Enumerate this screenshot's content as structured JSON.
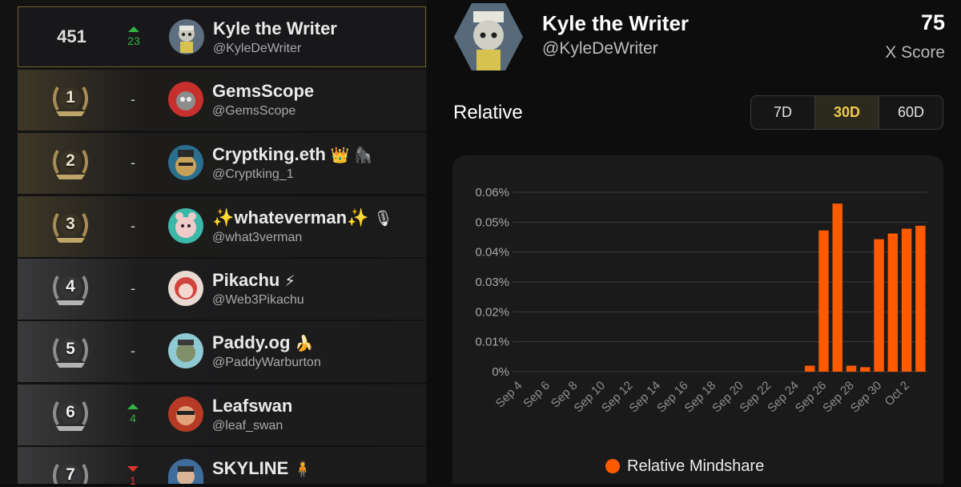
{
  "colors": {
    "accent_gold": "#f2c94c",
    "bar_orange": "#ff5a00",
    "up_green": "#2fb344",
    "down_red": "#e0322d"
  },
  "leaderboard": {
    "current_user": {
      "rank": "451",
      "change": "23",
      "change_dir": "up",
      "name": "Kyle the Writer",
      "handle": "@KyleDeWriter"
    },
    "rows": [
      {
        "rank": "1",
        "change": "-",
        "name": "GemsScope",
        "handle": "@GemsScope",
        "badges": ""
      },
      {
        "rank": "2",
        "change": "-",
        "name": "Cryptking.eth",
        "handle": "@Cryptking_1",
        "badges": "👑 🦍"
      },
      {
        "rank": "3",
        "change": "-",
        "name": "✨whateverman✨",
        "handle": "@what3verman",
        "badges": "🎙"
      },
      {
        "rank": "4",
        "change": "-",
        "name": "Pikachu",
        "handle": "@Web3Pikachu",
        "badges": "⚡"
      },
      {
        "rank": "5",
        "change": "-",
        "name": "Paddy.og",
        "handle": "@PaddyWarburton",
        "badges": "🍌"
      },
      {
        "rank": "6",
        "change": "4",
        "change_dir": "up",
        "name": "Leafswan",
        "handle": "@leaf_swan",
        "badges": ""
      },
      {
        "rank": "7",
        "change": "1",
        "change_dir": "down",
        "name": "SKYLINE",
        "handle": "",
        "badges": "🧍"
      }
    ]
  },
  "profile": {
    "name": "Kyle the Writer",
    "handle": "@KyleDeWriter",
    "score_value": "75",
    "score_label": "X Score"
  },
  "relative": {
    "title": "Relative",
    "ranges": [
      "7D",
      "30D",
      "60D"
    ],
    "selected_range": "30D"
  },
  "chart_data": {
    "type": "bar",
    "categories": [
      "Sep 4",
      "Sep 5",
      "Sep 6",
      "Sep 7",
      "Sep 8",
      "Sep 9",
      "Sep 10",
      "Sep 11",
      "Sep 12",
      "Sep 13",
      "Sep 14",
      "Sep 15",
      "Sep 16",
      "Sep 17",
      "Sep 18",
      "Sep 19",
      "Sep 20",
      "Sep 21",
      "Sep 22",
      "Sep 23",
      "Sep 24",
      "Sep 25",
      "Sep 26",
      "Sep 27",
      "Sep 28",
      "Sep 29",
      "Sep 30",
      "Oct 1",
      "Oct 2",
      "Oct 3"
    ],
    "tick_labels": [
      "Sep 4",
      "Sep 6",
      "Sep 8",
      "Sep 10",
      "Sep 12",
      "Sep 14",
      "Sep 16",
      "Sep 18",
      "Sep 20",
      "Sep 22",
      "Sep 24",
      "Sep 26",
      "Sep 28",
      "Sep 30",
      "Oct 2"
    ],
    "series": [
      {
        "name": "Relative Mindshare",
        "color": "#ff5a00",
        "values": [
          0,
          0,
          0,
          0,
          0,
          0,
          0,
          0,
          0,
          0,
          0,
          0,
          0,
          0,
          0,
          0,
          0,
          0,
          0,
          0,
          0,
          0.002,
          0.0472,
          0.0562,
          0.002,
          0.0015,
          0.0443,
          0.0462,
          0.0478,
          0.0488
        ]
      }
    ],
    "ylim": [
      0,
      0.06
    ],
    "yticks": [
      "0%",
      "0.01%",
      "0.02%",
      "0.03%",
      "0.04%",
      "0.05%",
      "0.06%"
    ],
    "grid": true,
    "legend": "bottom-center"
  }
}
